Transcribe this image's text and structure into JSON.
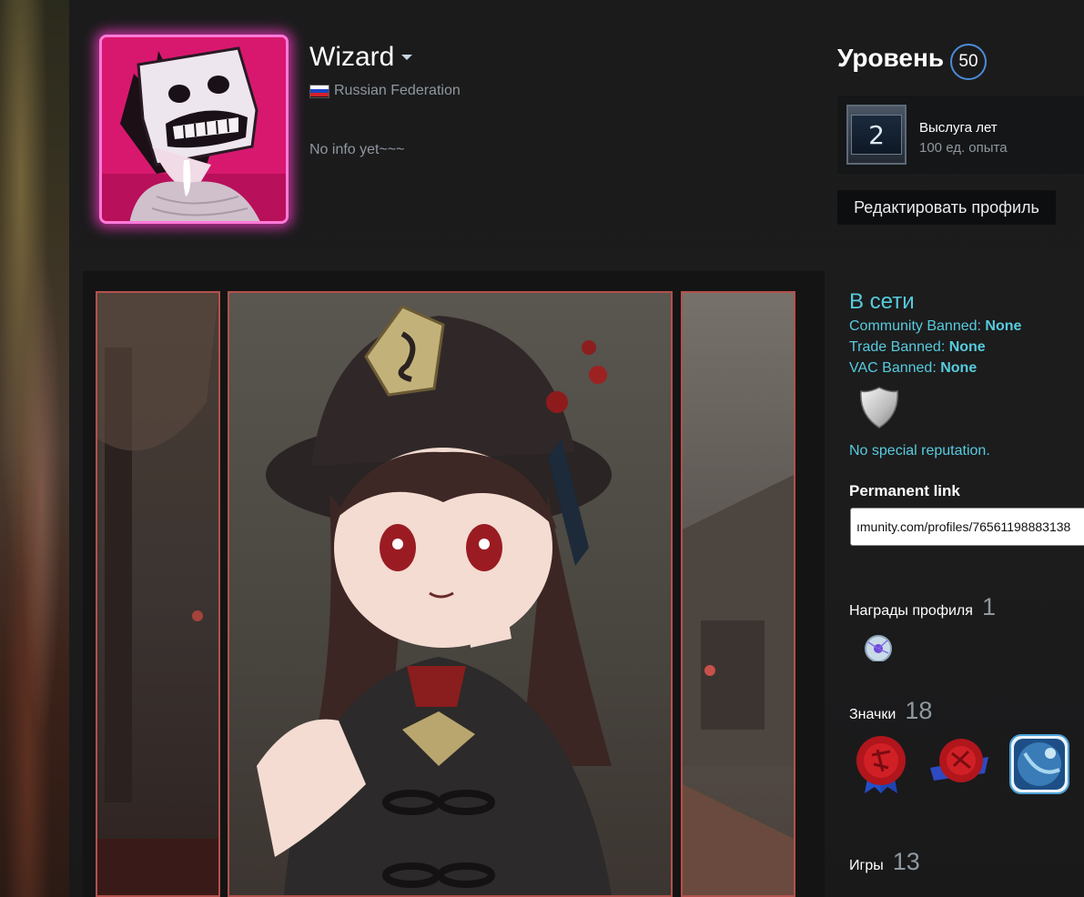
{
  "profile": {
    "name": "Wizard",
    "location": "Russian Federation",
    "summary": "No info yet~~~"
  },
  "level": {
    "label": "Уровень",
    "value": "50"
  },
  "years_badge": {
    "number": "2",
    "title": "Выслуга лет",
    "xp": "100 ед. опыта"
  },
  "edit_button": "Редактировать профиль",
  "status": {
    "online": "В сети",
    "community_label": "Community Banned: ",
    "community_value": "None",
    "trade_label": "Trade Banned: ",
    "trade_value": "None",
    "vac_label": "VAC Banned: ",
    "vac_value": "None",
    "reputation": "No special reputation."
  },
  "permanent_link": {
    "title": "Permanent link",
    "value": "ımunity.com/profiles/76561198883138"
  },
  "awards": {
    "label": "Награды профиля",
    "count": "1"
  },
  "badges": {
    "label": "Значки",
    "count": "18"
  },
  "games": {
    "label": "Игры",
    "count": "13"
  },
  "colors": {
    "accent": "#57cbde",
    "avatar_frame": "#ff7ad9",
    "level_ring": "#4c8bd6",
    "showcase_border": "#b3514d"
  }
}
